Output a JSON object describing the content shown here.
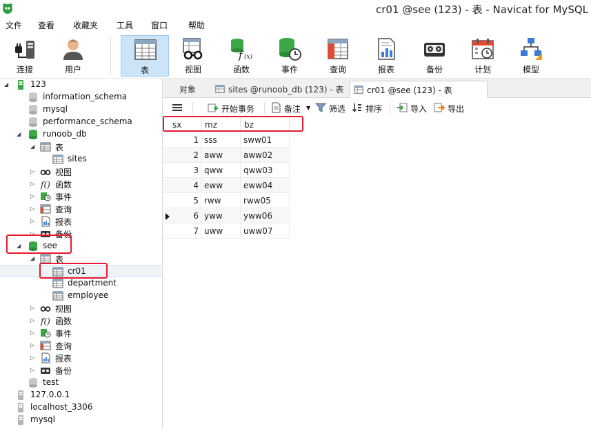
{
  "window": {
    "title": "cr01 @see (123) - 表 - Navicat for MySQL"
  },
  "menu": [
    "文件",
    "查看",
    "收藏夹",
    "工具",
    "窗口",
    "帮助"
  ],
  "toolbar": [
    {
      "label": "连接",
      "icon": "plug-icon"
    },
    {
      "label": "用户",
      "icon": "user-icon"
    },
    {
      "label": "表",
      "icon": "table-icon",
      "active": true
    },
    {
      "label": "视图",
      "icon": "view-icon"
    },
    {
      "label": "函数",
      "icon": "function-icon"
    },
    {
      "label": "事件",
      "icon": "event-icon"
    },
    {
      "label": "查询",
      "icon": "query-icon"
    },
    {
      "label": "报表",
      "icon": "report-icon"
    },
    {
      "label": "备份",
      "icon": "backup-icon"
    },
    {
      "label": "计划",
      "icon": "schedule-icon"
    },
    {
      "label": "模型",
      "icon": "model-icon"
    }
  ],
  "tree": [
    {
      "label": "123",
      "icon": "connection-icon",
      "arrow": "open"
    },
    {
      "label": "information_schema",
      "icon": "database-gray-icon"
    },
    {
      "label": "mysql",
      "icon": "database-gray-icon"
    },
    {
      "label": "performance_schema",
      "icon": "database-gray-icon"
    },
    {
      "label": "runoob_db",
      "icon": "database-green-icon",
      "arrow": "open"
    },
    {
      "label": "表",
      "icon": "table-icon",
      "arrow": "open"
    },
    {
      "label": "sites",
      "icon": "table-icon"
    },
    {
      "label": "视图",
      "icon": "view-icon",
      "arrow": "closed"
    },
    {
      "label": "函数",
      "icon": "function-icon",
      "arrow": "closed"
    },
    {
      "label": "事件",
      "icon": "event-icon",
      "arrow": "closed"
    },
    {
      "label": "查询",
      "icon": "query-icon",
      "arrow": "closed"
    },
    {
      "label": "报表",
      "icon": "report-icon",
      "arrow": "closed"
    },
    {
      "label": "备份",
      "icon": "backup-icon",
      "arrow": "closed"
    },
    {
      "label": "see",
      "icon": "database-green-icon",
      "arrow": "open"
    },
    {
      "label": "表",
      "icon": "table-icon",
      "arrow": "open"
    },
    {
      "label": "cr01",
      "icon": "table-icon",
      "selected": true
    },
    {
      "label": "department",
      "icon": "table-icon"
    },
    {
      "label": "employee",
      "icon": "table-icon"
    },
    {
      "label": "视图",
      "icon": "view-icon",
      "arrow": "closed"
    },
    {
      "label": "函数",
      "icon": "function-icon",
      "arrow": "closed"
    },
    {
      "label": "事件",
      "icon": "event-icon",
      "arrow": "closed"
    },
    {
      "label": "查询",
      "icon": "query-icon",
      "arrow": "closed"
    },
    {
      "label": "报表",
      "icon": "report-icon",
      "arrow": "closed"
    },
    {
      "label": "备份",
      "icon": "backup-icon",
      "arrow": "closed"
    },
    {
      "label": "test",
      "icon": "database-gray-icon"
    },
    {
      "label": "127.0.0.1",
      "icon": "connection-gray-icon"
    },
    {
      "label": "localhost_3306",
      "icon": "connection-gray-icon"
    },
    {
      "label": "mysql",
      "icon": "connection-gray-icon"
    }
  ],
  "tabs": [
    {
      "label": "对象"
    },
    {
      "label": "sites @runoob_db (123) - 表",
      "icon": "table-icon"
    },
    {
      "label": "cr01 @see (123) - 表",
      "icon": "table-icon",
      "active": true
    }
  ],
  "subtoolbar": {
    "begin_transaction": "开始事务",
    "memo": "备注",
    "filter": "筛选",
    "sort": "排序",
    "import": "导入",
    "export": "导出"
  },
  "grid": {
    "columns": [
      "sx",
      "mz",
      "bz"
    ],
    "rows": [
      [
        "1",
        "sss",
        "sww01"
      ],
      [
        "2",
        "aww",
        "aww02"
      ],
      [
        "3",
        "qww",
        "qww03"
      ],
      [
        "4",
        "eww",
        "eww04"
      ],
      [
        "5",
        "rww",
        "rww05"
      ],
      [
        "6",
        "yww",
        "yww06"
      ],
      [
        "7",
        "uww",
        "uww07"
      ]
    ],
    "current_row": 5
  },
  "colors": {
    "accent": "#cce4f7",
    "highlight": "#e8192c",
    "db_green": "#3aa845"
  }
}
